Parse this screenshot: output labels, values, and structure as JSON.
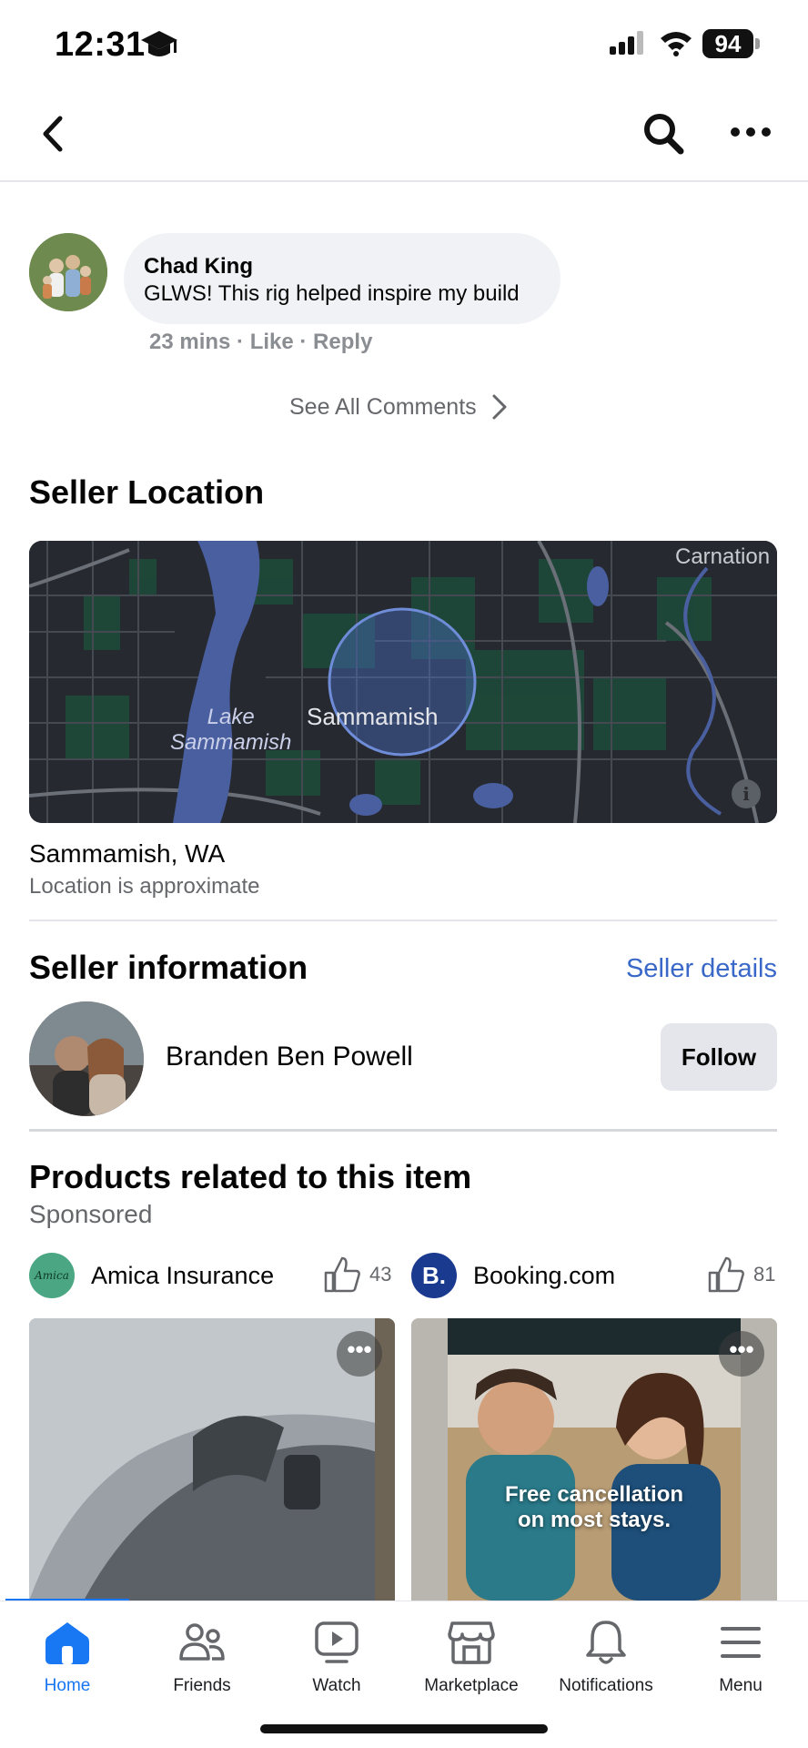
{
  "status_bar": {
    "time": "12:31",
    "battery": "94"
  },
  "comment": {
    "author": "Chad King",
    "text": "GLWS! This rig helped inspire my build",
    "meta": "23 mins · Like · Reply"
  },
  "see_all_comments": "See All Comments",
  "seller_location": {
    "title": "Seller Location",
    "map_labels": {
      "lake": "Lake\nSammamish",
      "city": "Sammamish",
      "nearby": "Carnation"
    },
    "city": "Sammamish, WA",
    "note": "Location is approximate"
  },
  "seller_info": {
    "title": "Seller information",
    "details_link": "Seller details",
    "name": "Branden Ben Powell",
    "follow_label": "Follow"
  },
  "products": {
    "title": "Products related to this item",
    "sponsored": "Sponsored",
    "ads": [
      {
        "name": "Amica Insurance",
        "logo_text": "Amica",
        "likes": "43",
        "logo_color": "#4aa683"
      },
      {
        "name": "Booking.com",
        "logo_text": "B.",
        "likes": "81",
        "logo_color": "#1a3a8f"
      }
    ],
    "card_right_text": "Free cancellation\non most stays.",
    "card_menu": "•••"
  },
  "tabs": [
    {
      "label": "Home",
      "icon": "home-icon",
      "active": true
    },
    {
      "label": "Friends",
      "icon": "friends-icon"
    },
    {
      "label": "Watch",
      "icon": "watch-icon"
    },
    {
      "label": "Marketplace",
      "icon": "marketplace-icon"
    },
    {
      "label": "Notifications",
      "icon": "bell-icon"
    },
    {
      "label": "Menu",
      "icon": "menu-icon"
    }
  ],
  "colors": {
    "accent": "#1877f2",
    "link": "#3a68c8",
    "bubble": "#f0f2f5"
  }
}
